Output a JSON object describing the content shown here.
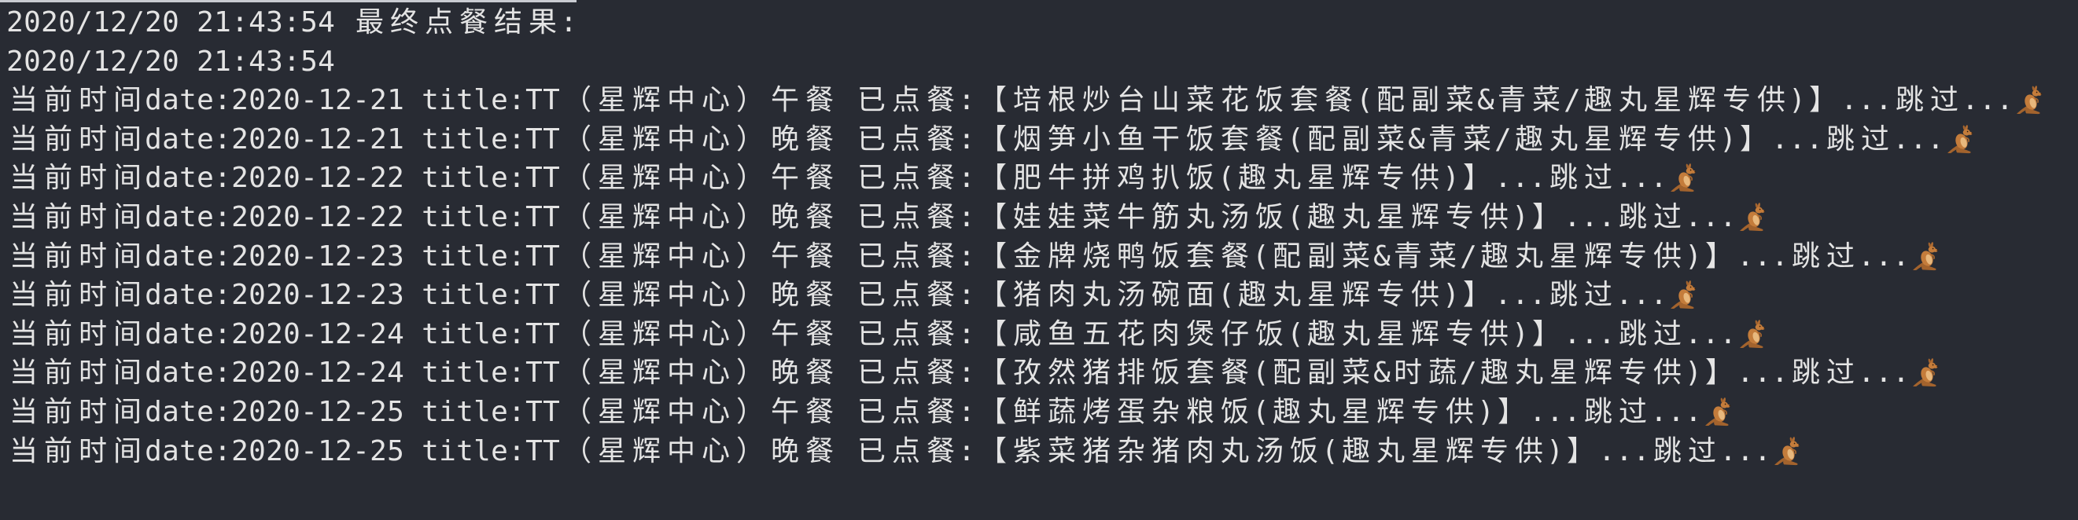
{
  "colors": {
    "background": "#282b33",
    "text": "#e4e4e4"
  },
  "terminal": {
    "lines": [
      {
        "text": "2020/12/20 21:43:54 最终点餐结果:"
      },
      {
        "text": "2020/12/20 21:43:54"
      },
      {
        "text": "当前时间date:2020-12-21 title:TT（星辉中心）午餐 已点餐:【培根炒台山菜花饭套餐(配副菜&青菜/趣丸星辉专供)】...跳过...",
        "icon": "kangaroo-icon"
      },
      {
        "text": "当前时间date:2020-12-21 title:TT（星辉中心）晚餐 已点餐:【烟笋小鱼干饭套餐(配副菜&青菜/趣丸星辉专供)】...跳过...",
        "icon": "kangaroo-icon"
      },
      {
        "text": "当前时间date:2020-12-22 title:TT（星辉中心）午餐 已点餐:【肥牛拼鸡扒饭(趣丸星辉专供)】...跳过...",
        "icon": "kangaroo-icon"
      },
      {
        "text": "当前时间date:2020-12-22 title:TT（星辉中心）晚餐 已点餐:【娃娃菜牛筋丸汤饭(趣丸星辉专供)】...跳过...",
        "icon": "kangaroo-icon"
      },
      {
        "text": "当前时间date:2020-12-23 title:TT（星辉中心）午餐 已点餐:【金牌烧鸭饭套餐(配副菜&青菜/趣丸星辉专供)】...跳过...",
        "icon": "kangaroo-icon"
      },
      {
        "text": "当前时间date:2020-12-23 title:TT（星辉中心）晚餐 已点餐:【猪肉丸汤碗面(趣丸星辉专供)】...跳过...",
        "icon": "kangaroo-icon"
      },
      {
        "text": "当前时间date:2020-12-24 title:TT（星辉中心）午餐 已点餐:【咸鱼五花肉煲仔饭(趣丸星辉专供)】...跳过...",
        "icon": "kangaroo-icon"
      },
      {
        "text": "当前时间date:2020-12-24 title:TT（星辉中心）晚餐 已点餐:【孜然猪排饭套餐(配副菜&时蔬/趣丸星辉专供)】...跳过...",
        "icon": "kangaroo-icon"
      },
      {
        "text": "当前时间date:2020-12-25 title:TT（星辉中心）午餐 已点餐:【鲜蔬烤蛋杂粮饭(趣丸星辉专供)】...跳过...",
        "icon": "kangaroo-icon"
      },
      {
        "text": "当前时间date:2020-12-25 title:TT（星辉中心）晚餐 已点餐:【紫菜猪杂猪肉丸汤饭(趣丸星辉专供)】...跳过...",
        "icon": "kangaroo-icon"
      }
    ]
  }
}
